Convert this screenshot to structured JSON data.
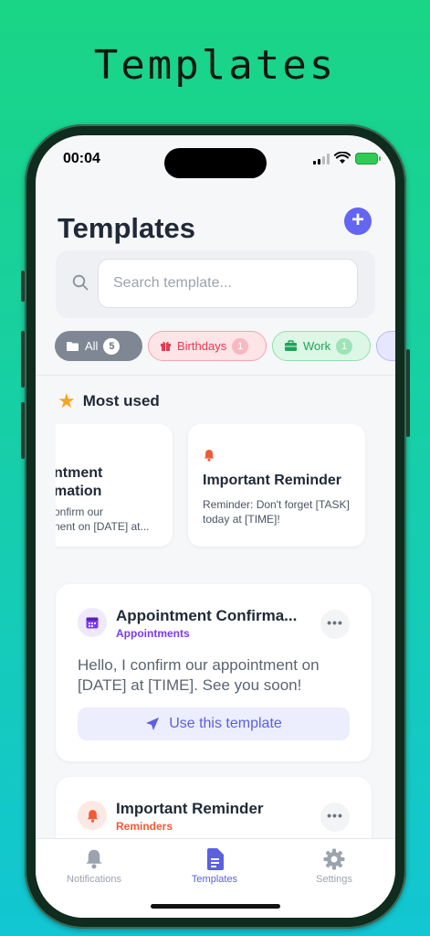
{
  "banner": {
    "title": "Templates"
  },
  "status_bar": {
    "time": "00:04"
  },
  "header": {
    "title": "Templates",
    "add_label": "+"
  },
  "search": {
    "placeholder": "Search template...",
    "value": ""
  },
  "filters": [
    {
      "label": "All",
      "count": "5"
    },
    {
      "label": "Birthdays",
      "count": "1"
    },
    {
      "label": "Work",
      "count": "1"
    }
  ],
  "most_used": {
    "heading": "Most used",
    "cards": [
      {
        "title": "ntment\nmation",
        "title_line1": "ntment",
        "title_line2": "mation",
        "body_line1": "onfirm our",
        "body_line2": "nent on [DATE] at..."
      },
      {
        "title": "Important Reminder",
        "body": "Reminder: Don't forget [TASK] today at [TIME]!"
      }
    ]
  },
  "templates": [
    {
      "title": "Appointment Confirma...",
      "category": "Appointments",
      "body": "Hello, I confirm our appointment on [DATE] at [TIME]. See you soon!",
      "action": "Use this template",
      "category_color": "#7c3aed",
      "icon": "calendar-icon"
    },
    {
      "title": "Important Reminder",
      "category": "Reminders",
      "category_color": "#f15a38",
      "icon": "bell-icon"
    }
  ],
  "tabbar": [
    {
      "label": "Notifications",
      "icon": "bell-icon"
    },
    {
      "label": "Templates",
      "icon": "document-icon",
      "active": true
    },
    {
      "label": "Settings",
      "icon": "gear-icon"
    }
  ],
  "colors": {
    "accent": "#6366f1",
    "background_gradient_top": "#19d585",
    "background_gradient_bottom": "#12c6d3"
  }
}
